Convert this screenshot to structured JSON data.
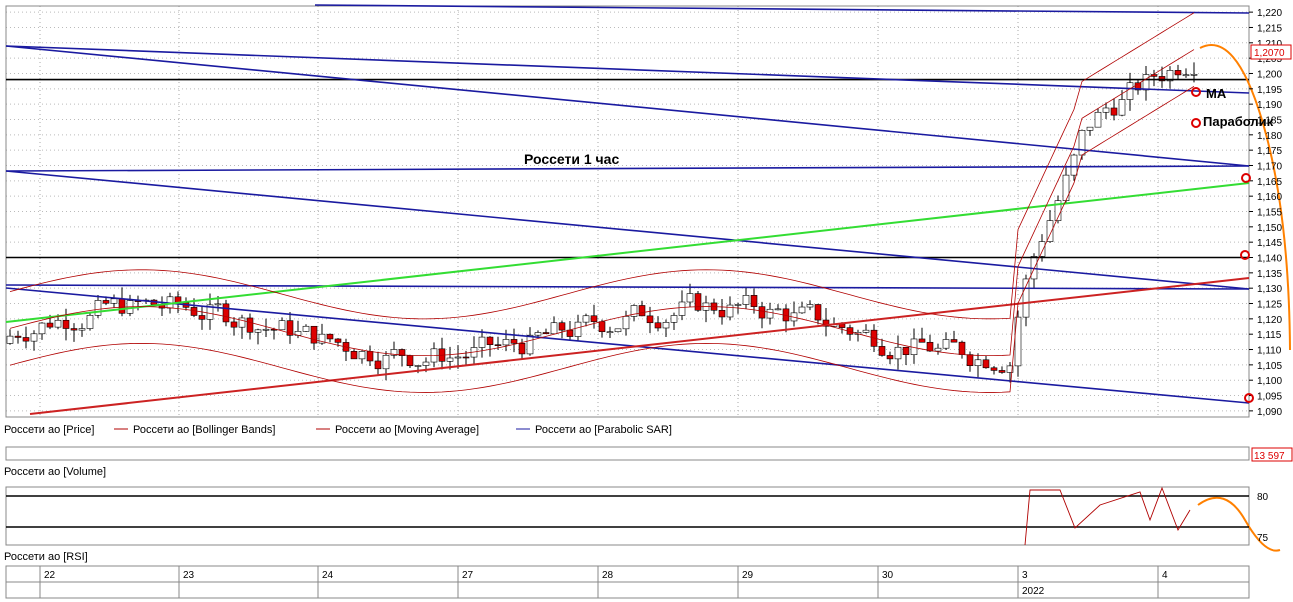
{
  "chart_data": {
    "type": "candlestick",
    "title": "Россети   1 час",
    "price_axis": {
      "ylim": [
        1.088,
        1.222
      ],
      "ticks": [
        "1,220",
        "1,215",
        "1,210",
        "1,205",
        "1,200",
        "1,195",
        "1,190",
        "1,185",
        "1,180",
        "1,175",
        "1,170",
        "1,165",
        "1,160",
        "1,155",
        "1,150",
        "1,145",
        "1,140",
        "1,135",
        "1,130",
        "1,125",
        "1,120",
        "1,115",
        "1,110",
        "1,105",
        "1,100",
        "1,095",
        "1,090"
      ],
      "last_price_label": "1,2070"
    },
    "time_axis": {
      "day_labels": [
        "22",
        "23",
        "24",
        "27",
        "28",
        "29",
        "30",
        "3",
        "4"
      ],
      "year_label": "2022"
    },
    "legend": [
      {
        "name": "Россети ао [Price]",
        "color": ""
      },
      {
        "name": "Россети ао [Bollinger Bands]",
        "color": "#b00000"
      },
      {
        "name": "Россети ао [Moving Average]",
        "color": "#b00000"
      },
      {
        "name": "Россети ао [Parabolic SAR]",
        "color": "#1a1aa0"
      }
    ],
    "annotations": [
      "MA",
      "Параболик"
    ],
    "volume": {
      "label": "Россети ао [Volume]",
      "value_label": "13 597"
    },
    "rsi": {
      "label": "Россети ао [RSI]",
      "levels": [
        "80",
        "75"
      ]
    },
    "colors": {
      "up_candle": "#ffffff",
      "down_candle": "#dd0000",
      "channel": "#1a1aa0",
      "support": "#33dd33",
      "trend": "#cc2222",
      "forecast": "#ff8000"
    }
  }
}
